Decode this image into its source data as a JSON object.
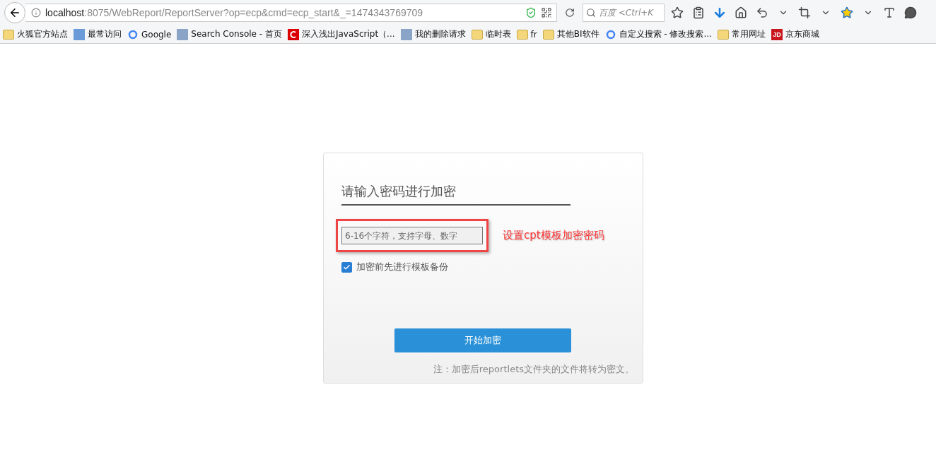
{
  "browser": {
    "url_host": "localhost",
    "url_path": ":8075/WebReport/ReportServer?op=ecp&cmd=ecp_start&_=1474343769709",
    "search_placeholder": "百度 <Ctrl+K"
  },
  "bookmarks": [
    {
      "kind": "folder",
      "label": "火狐官方站点"
    },
    {
      "kind": "page",
      "label": "最常访问"
    },
    {
      "kind": "google",
      "label": "Google"
    },
    {
      "kind": "console",
      "label": "Search Console - 首页"
    },
    {
      "kind": "redc",
      "label": "深入浅出JavaScript（..."
    },
    {
      "kind": "console",
      "label": "我的删除请求"
    },
    {
      "kind": "folder",
      "label": "临时表"
    },
    {
      "kind": "folder",
      "label": "fr"
    },
    {
      "kind": "folder",
      "label": "其他BI软件"
    },
    {
      "kind": "google",
      "label": "自定义搜索 - 修改搜索..."
    },
    {
      "kind": "folder",
      "label": "常用网址"
    },
    {
      "kind": "jd",
      "label": "京东商城",
      "badge": "JD"
    }
  ],
  "card": {
    "title": "请输入密码进行加密",
    "password_placeholder": "6-16个字符，支持字母、数字",
    "annotation": "设置cpt模板加密密码",
    "backup": {
      "label": "加密前先进行模板备份",
      "checked": true
    },
    "button": "开始加密",
    "note": "注：加密后reportlets文件夹的文件将转为密文。"
  }
}
